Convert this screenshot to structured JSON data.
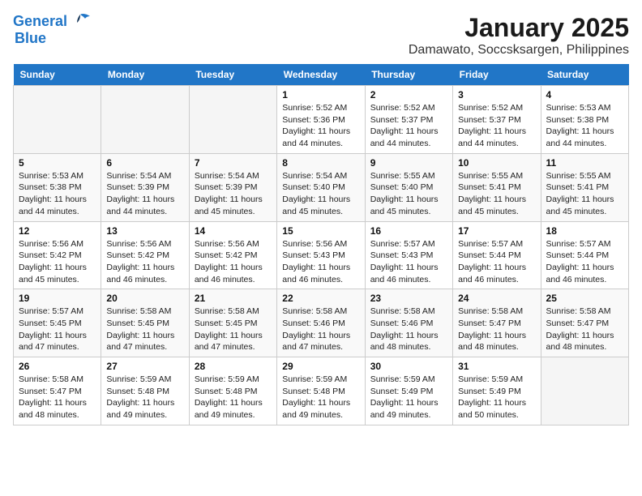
{
  "logo": {
    "line1": "General",
    "line2": "Blue"
  },
  "title": "January 2025",
  "subtitle": "Damawato, Soccsksargen, Philippines",
  "weekdays": [
    "Sunday",
    "Monday",
    "Tuesday",
    "Wednesday",
    "Thursday",
    "Friday",
    "Saturday"
  ],
  "weeks": [
    [
      {
        "day": "",
        "info": ""
      },
      {
        "day": "",
        "info": ""
      },
      {
        "day": "",
        "info": ""
      },
      {
        "day": "1",
        "info": "Sunrise: 5:52 AM\nSunset: 5:36 PM\nDaylight: 11 hours and 44 minutes."
      },
      {
        "day": "2",
        "info": "Sunrise: 5:52 AM\nSunset: 5:37 PM\nDaylight: 11 hours and 44 minutes."
      },
      {
        "day": "3",
        "info": "Sunrise: 5:52 AM\nSunset: 5:37 PM\nDaylight: 11 hours and 44 minutes."
      },
      {
        "day": "4",
        "info": "Sunrise: 5:53 AM\nSunset: 5:38 PM\nDaylight: 11 hours and 44 minutes."
      }
    ],
    [
      {
        "day": "5",
        "info": "Sunrise: 5:53 AM\nSunset: 5:38 PM\nDaylight: 11 hours and 44 minutes."
      },
      {
        "day": "6",
        "info": "Sunrise: 5:54 AM\nSunset: 5:39 PM\nDaylight: 11 hours and 44 minutes."
      },
      {
        "day": "7",
        "info": "Sunrise: 5:54 AM\nSunset: 5:39 PM\nDaylight: 11 hours and 45 minutes."
      },
      {
        "day": "8",
        "info": "Sunrise: 5:54 AM\nSunset: 5:40 PM\nDaylight: 11 hours and 45 minutes."
      },
      {
        "day": "9",
        "info": "Sunrise: 5:55 AM\nSunset: 5:40 PM\nDaylight: 11 hours and 45 minutes."
      },
      {
        "day": "10",
        "info": "Sunrise: 5:55 AM\nSunset: 5:41 PM\nDaylight: 11 hours and 45 minutes."
      },
      {
        "day": "11",
        "info": "Sunrise: 5:55 AM\nSunset: 5:41 PM\nDaylight: 11 hours and 45 minutes."
      }
    ],
    [
      {
        "day": "12",
        "info": "Sunrise: 5:56 AM\nSunset: 5:42 PM\nDaylight: 11 hours and 45 minutes."
      },
      {
        "day": "13",
        "info": "Sunrise: 5:56 AM\nSunset: 5:42 PM\nDaylight: 11 hours and 46 minutes."
      },
      {
        "day": "14",
        "info": "Sunrise: 5:56 AM\nSunset: 5:42 PM\nDaylight: 11 hours and 46 minutes."
      },
      {
        "day": "15",
        "info": "Sunrise: 5:56 AM\nSunset: 5:43 PM\nDaylight: 11 hours and 46 minutes."
      },
      {
        "day": "16",
        "info": "Sunrise: 5:57 AM\nSunset: 5:43 PM\nDaylight: 11 hours and 46 minutes."
      },
      {
        "day": "17",
        "info": "Sunrise: 5:57 AM\nSunset: 5:44 PM\nDaylight: 11 hours and 46 minutes."
      },
      {
        "day": "18",
        "info": "Sunrise: 5:57 AM\nSunset: 5:44 PM\nDaylight: 11 hours and 46 minutes."
      }
    ],
    [
      {
        "day": "19",
        "info": "Sunrise: 5:57 AM\nSunset: 5:45 PM\nDaylight: 11 hours and 47 minutes."
      },
      {
        "day": "20",
        "info": "Sunrise: 5:58 AM\nSunset: 5:45 PM\nDaylight: 11 hours and 47 minutes."
      },
      {
        "day": "21",
        "info": "Sunrise: 5:58 AM\nSunset: 5:45 PM\nDaylight: 11 hours and 47 minutes."
      },
      {
        "day": "22",
        "info": "Sunrise: 5:58 AM\nSunset: 5:46 PM\nDaylight: 11 hours and 47 minutes."
      },
      {
        "day": "23",
        "info": "Sunrise: 5:58 AM\nSunset: 5:46 PM\nDaylight: 11 hours and 48 minutes."
      },
      {
        "day": "24",
        "info": "Sunrise: 5:58 AM\nSunset: 5:47 PM\nDaylight: 11 hours and 48 minutes."
      },
      {
        "day": "25",
        "info": "Sunrise: 5:58 AM\nSunset: 5:47 PM\nDaylight: 11 hours and 48 minutes."
      }
    ],
    [
      {
        "day": "26",
        "info": "Sunrise: 5:58 AM\nSunset: 5:47 PM\nDaylight: 11 hours and 48 minutes."
      },
      {
        "day": "27",
        "info": "Sunrise: 5:59 AM\nSunset: 5:48 PM\nDaylight: 11 hours and 49 minutes."
      },
      {
        "day": "28",
        "info": "Sunrise: 5:59 AM\nSunset: 5:48 PM\nDaylight: 11 hours and 49 minutes."
      },
      {
        "day": "29",
        "info": "Sunrise: 5:59 AM\nSunset: 5:48 PM\nDaylight: 11 hours and 49 minutes."
      },
      {
        "day": "30",
        "info": "Sunrise: 5:59 AM\nSunset: 5:49 PM\nDaylight: 11 hours and 49 minutes."
      },
      {
        "day": "31",
        "info": "Sunrise: 5:59 AM\nSunset: 5:49 PM\nDaylight: 11 hours and 50 minutes."
      },
      {
        "day": "",
        "info": ""
      }
    ]
  ]
}
